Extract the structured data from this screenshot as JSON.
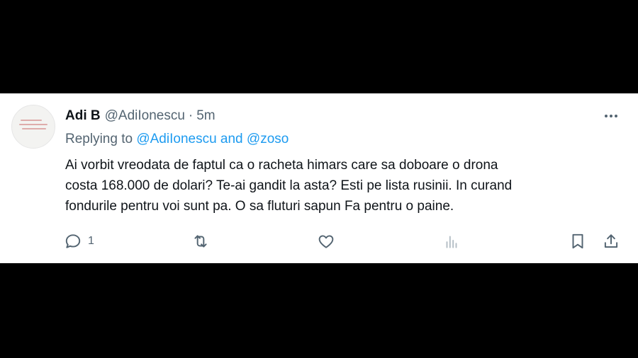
{
  "tweet": {
    "author_name": "Adi B",
    "author_handle": "@AdiIonescu",
    "separator": "·",
    "time": "5m",
    "replying_prefix": "Replying to",
    "mention_1": "@AdiIonescu",
    "mention_conjunction": "and",
    "mention_2": "@zoso",
    "text_lines": [
      "Ai vorbit vreodata de faptul ca o racheta himars care sa doboare o drona",
      "costa 168.000 de dolari? Te-ai gandit la asta? Esti pe lista rusinii. In curand",
      "fondurile pentru voi sunt pa. O sa fluturi sapun Fa pentru o paine."
    ]
  },
  "actions": {
    "reply_count": "1",
    "retweet_count": "",
    "like_count": ""
  },
  "icons": {
    "more": "more-dots-icon",
    "reply": "reply-bubble-icon",
    "retweet": "retweet-icon",
    "like": "heart-icon",
    "views": "analytics-bars-icon",
    "bookmark": "bookmark-icon",
    "share": "share-upload-icon"
  },
  "colors": {
    "accent": "#1d9bf0",
    "text": "#0f1419",
    "muted": "#536471"
  }
}
